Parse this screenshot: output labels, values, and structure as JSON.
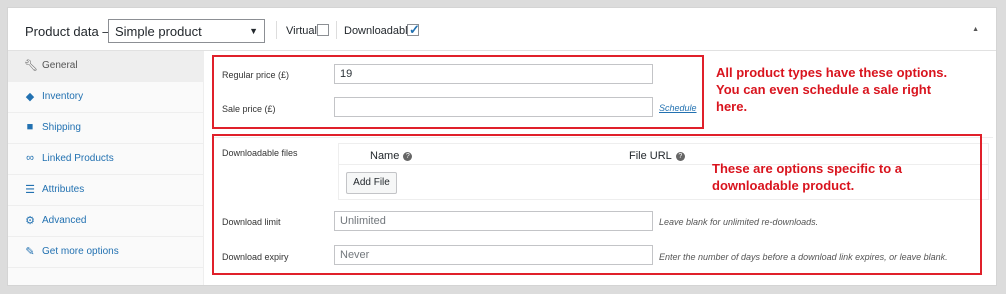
{
  "header": {
    "title": "Product data —",
    "product_type": "Simple product",
    "virtual_label": "Virtual:",
    "virtual_checked": false,
    "downloadable_label": "Downloadable:",
    "downloadable_checked": true
  },
  "sidebar": {
    "items": [
      {
        "label": "General",
        "icon": "wrench-icon",
        "active": true
      },
      {
        "label": "Inventory",
        "icon": "tag-icon",
        "active": false
      },
      {
        "label": "Shipping",
        "icon": "truck-icon",
        "active": false
      },
      {
        "label": "Linked Products",
        "icon": "link-icon",
        "active": false
      },
      {
        "label": "Attributes",
        "icon": "list-icon",
        "active": false
      },
      {
        "label": "Advanced",
        "icon": "gear-icon",
        "active": false
      },
      {
        "label": "Get more options",
        "icon": "plugin-icon",
        "active": false
      }
    ]
  },
  "pricing": {
    "regular_price_label": "Regular price (£)",
    "regular_price_value": "19",
    "sale_price_label": "Sale price (£)",
    "sale_price_value": "",
    "schedule_link": "Schedule"
  },
  "downloads": {
    "files_label": "Downloadable files",
    "col_name": "Name",
    "col_url": "File URL",
    "add_file_label": "Add File",
    "limit_label": "Download limit",
    "limit_placeholder": "Unlimited",
    "limit_desc": "Leave blank for unlimited re-downloads.",
    "expiry_label": "Download expiry",
    "expiry_placeholder": "Never",
    "expiry_desc": "Enter the number of days before a download link expires, or leave blank."
  },
  "annotations": {
    "note_general": [
      "All product types have these options.",
      "You can even schedule a sale right",
      "here."
    ],
    "note_downloadable": [
      "These are options specific to a",
      "downloadable product."
    ],
    "highlight_color": "#e0202a"
  }
}
